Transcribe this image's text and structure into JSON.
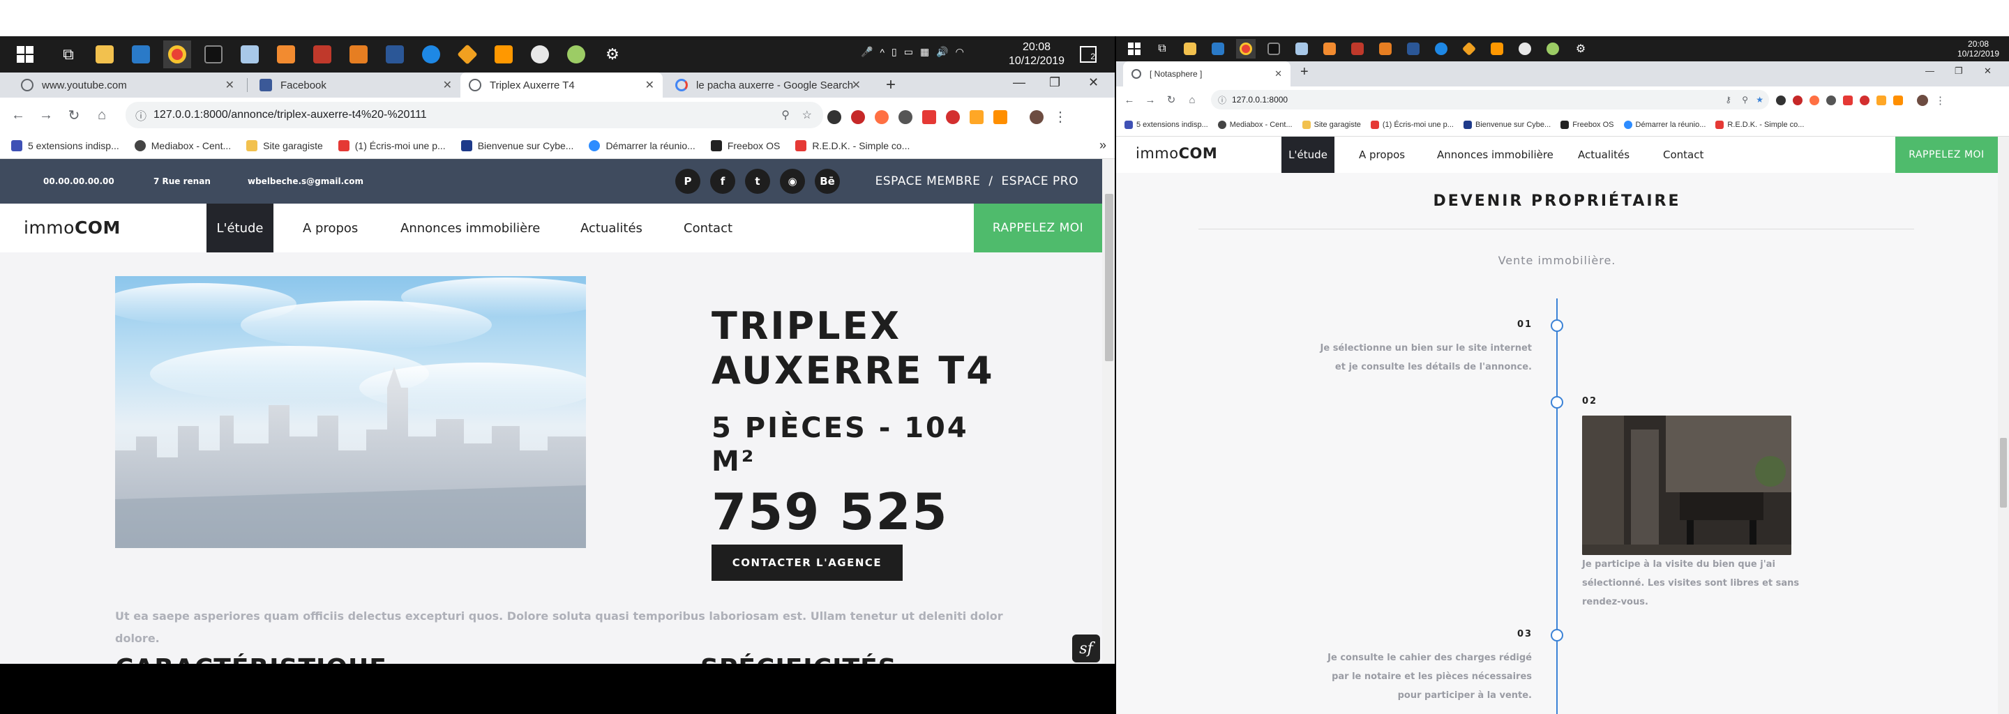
{
  "taskbar_left": {
    "time": "20:08",
    "date": "10/12/2019",
    "notifications": "2"
  },
  "taskbar_right": {
    "time": "20:08",
    "date": "10/12/2019"
  },
  "left_browser": {
    "tabs": [
      {
        "label": "www.youtube.com",
        "icon": "globe-icon",
        "color": "#1a73e8"
      },
      {
        "label": "Facebook",
        "icon": "facebook-icon",
        "color": "#3b5998"
      },
      {
        "label": "Triplex Auxerre T4",
        "icon": "globe-icon",
        "color": "#5f6368"
      },
      {
        "label": "le pacha auxerre - Google Search",
        "icon": "google-icon",
        "color": "#4285f4"
      }
    ],
    "url": "127.0.0.1:8000/annonce/triplex-auxerre-t4%20-%20111",
    "bookmarks": [
      "5 extensions indisp...",
      "Mediabox - Cent...",
      "Site garagiste",
      "(1) Écris-moi une p...",
      "Bienvenue sur Cybe...",
      "Démarrer la réunio...",
      "Freebox OS",
      "R.E.D.K. - Simple co..."
    ],
    "more": "»"
  },
  "left_page": {
    "topbar": {
      "phone": "00.00.00.00.00",
      "address": "7 Rue renan",
      "email": "wbelbeche.s@gmail.com",
      "social": [
        "P",
        "f",
        "t",
        "◉",
        "Bē"
      ],
      "member_link": "ESPACE MEMBRE",
      "sep": "/",
      "pro_link": "ESPACE PRO"
    },
    "nav": {
      "logo_light": "immo",
      "logo_bold": "COM",
      "items": [
        "L'étude",
        "A propos",
        "Annonces immobilière",
        "Actualités",
        "Contact"
      ],
      "cta": "RAPPELEZ MOI"
    },
    "property": {
      "title_line1": "TRIPLEX",
      "title_line2": "AUXERRE T4",
      "rooms_line1": "5 PIÈCES - 104",
      "rooms_line2": "M²",
      "price": "759 525",
      "contact_btn": "CONTACTER L'AGENCE",
      "description_line1": "Ut ea saepe asperiores quam officiis delectus excepturi quos. Dolore soluta quasi temporibus laboriosam est. Ullam tenetur ut deleniti dolor",
      "description_line2": "dolore.",
      "heading_left": "CARACTÉRISTIQUE",
      "heading_right": "SPÉCIFICITÉS"
    }
  },
  "right_browser": {
    "tab": "[ Notasphere ]",
    "url": "127.0.0.1:8000",
    "bookmarks": [
      "5 extensions indisp...",
      "Mediabox - Cent...",
      "Site garagiste",
      "(1) Écris-moi une p...",
      "Bienvenue sur Cybe...",
      "Freebox OS",
      "Démarrer la réunio...",
      "R.E.D.K. - Simple co..."
    ]
  },
  "right_page": {
    "nav": {
      "logo_light": "immo",
      "logo_bold": "COM",
      "items": [
        "L'étude",
        "A propos",
        "Annonces immobilière",
        "Actualités",
        "Contact"
      ],
      "cta": "RAPPELEZ MOI"
    },
    "section_title": "DEVENIR PROPRIÉTAIRE",
    "section_subtitle": "Vente immobilière.",
    "steps": [
      {
        "num": "01",
        "line1": "Je sélectionne un bien sur le site internet",
        "line2": "et je consulte les détails de l'annonce."
      },
      {
        "num": "02",
        "line1": "Je participe à la visite du bien que j'ai",
        "line2": "sélectionné. Les visites sont libres et sans",
        "line3": "rendez-vous."
      },
      {
        "num": "03",
        "line1": "Je consulte le cahier des charges rédigé",
        "line2": "par le notaire et les pièces nécessaires",
        "line3": "pour participer à la vente."
      }
    ]
  },
  "colors": {
    "accent_green": "#4fbb6c",
    "topbar": "#3f4b5e",
    "timeline_blue": "#3b82d6"
  }
}
